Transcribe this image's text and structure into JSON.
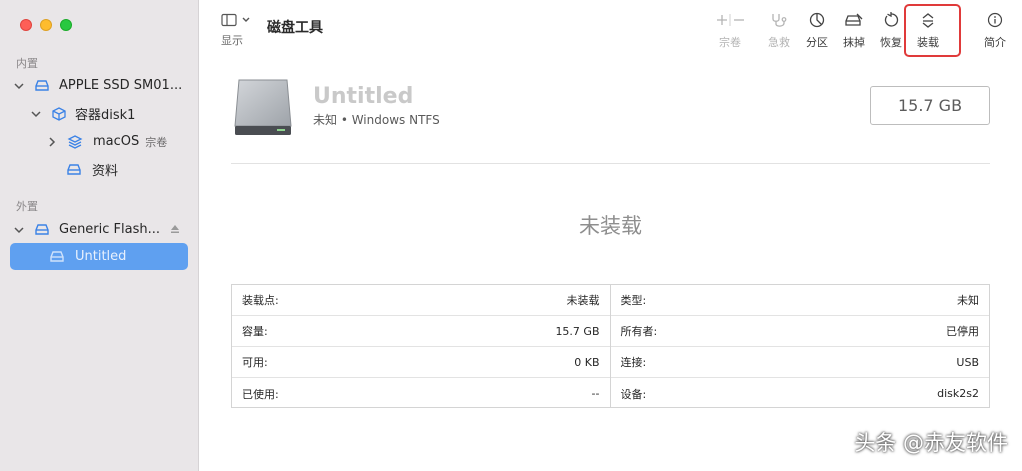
{
  "sidebar": {
    "internal_label": "内置",
    "external_label": "外置",
    "items": [
      {
        "label": "APPLE SSD SM01..."
      },
      {
        "label": "容器disk1"
      },
      {
        "label": "macOS",
        "sub": "宗卷"
      },
      {
        "label": "资料"
      },
      {
        "label": "Generic Flash..."
      },
      {
        "label": "Untitled"
      }
    ]
  },
  "toolbar": {
    "view_label": "显示",
    "title": "磁盘工具",
    "buttons": {
      "volume": "宗卷",
      "firstaid": "急救",
      "partition": "分区",
      "erase": "抹掉",
      "restore": "恢复",
      "mount": "装载",
      "info": "简介"
    }
  },
  "volume": {
    "name": "Untitled",
    "description": "未知 • Windows NTFS",
    "size": "15.7 GB",
    "status": "未装载"
  },
  "info": {
    "left": [
      {
        "key": "装载点:",
        "value": "未装载"
      },
      {
        "key": "容量:",
        "value": "15.7 GB"
      },
      {
        "key": "可用:",
        "value": "0 KB"
      },
      {
        "key": "已使用:",
        "value": "--"
      }
    ],
    "right": [
      {
        "key": "类型:",
        "value": "未知"
      },
      {
        "key": "所有者:",
        "value": "已停用"
      },
      {
        "key": "连接:",
        "value": "USB"
      },
      {
        "key": "设备:",
        "value": "disk2s2"
      }
    ]
  },
  "watermark": "头条 @赤友软件",
  "colors": {
    "selection": "#5fa0f0",
    "highlight": "#e03a3a"
  }
}
